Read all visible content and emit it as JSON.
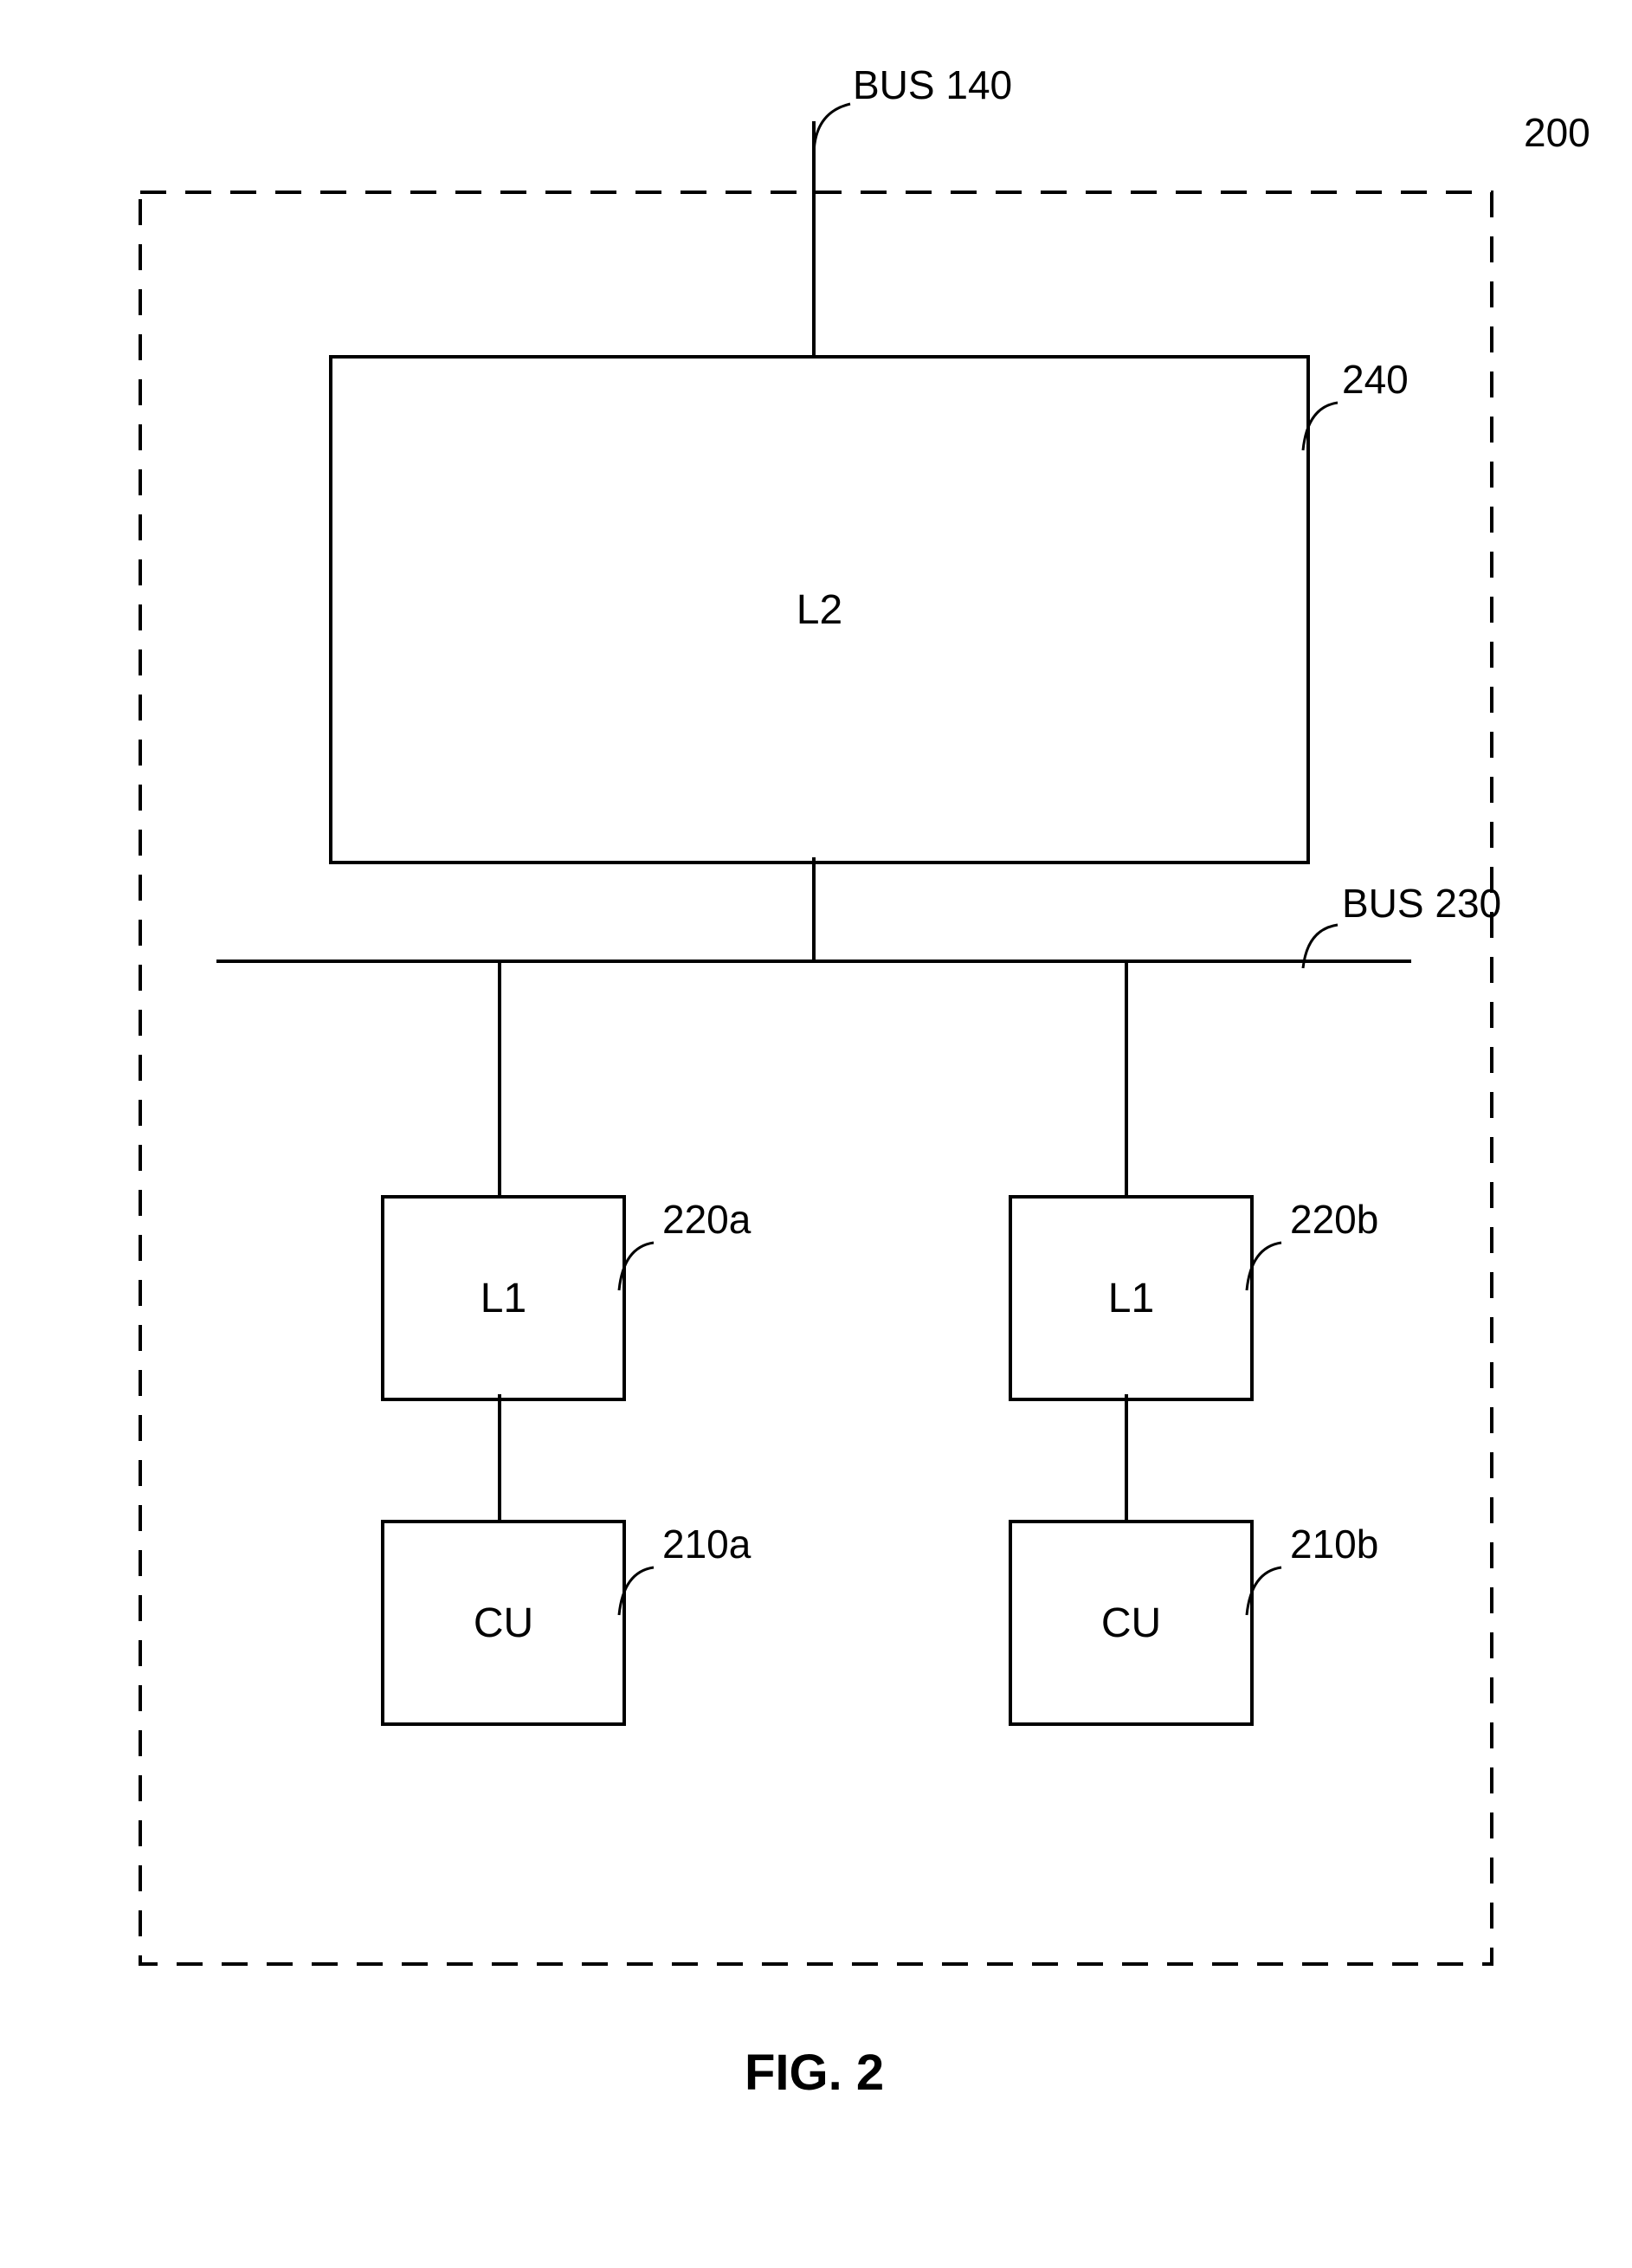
{
  "figure": {
    "caption": "FIG. 2",
    "assembly_ref": "200",
    "bus_top": "BUS 140",
    "bus_mid": "BUS 230"
  },
  "blocks": {
    "l2": {
      "label": "L2",
      "ref": "240"
    },
    "l1a": {
      "label": "L1",
      "ref": "220a"
    },
    "l1b": {
      "label": "L1",
      "ref": "220b"
    },
    "cua": {
      "label": "CU",
      "ref": "210a"
    },
    "cub": {
      "label": "CU",
      "ref": "210b"
    }
  }
}
